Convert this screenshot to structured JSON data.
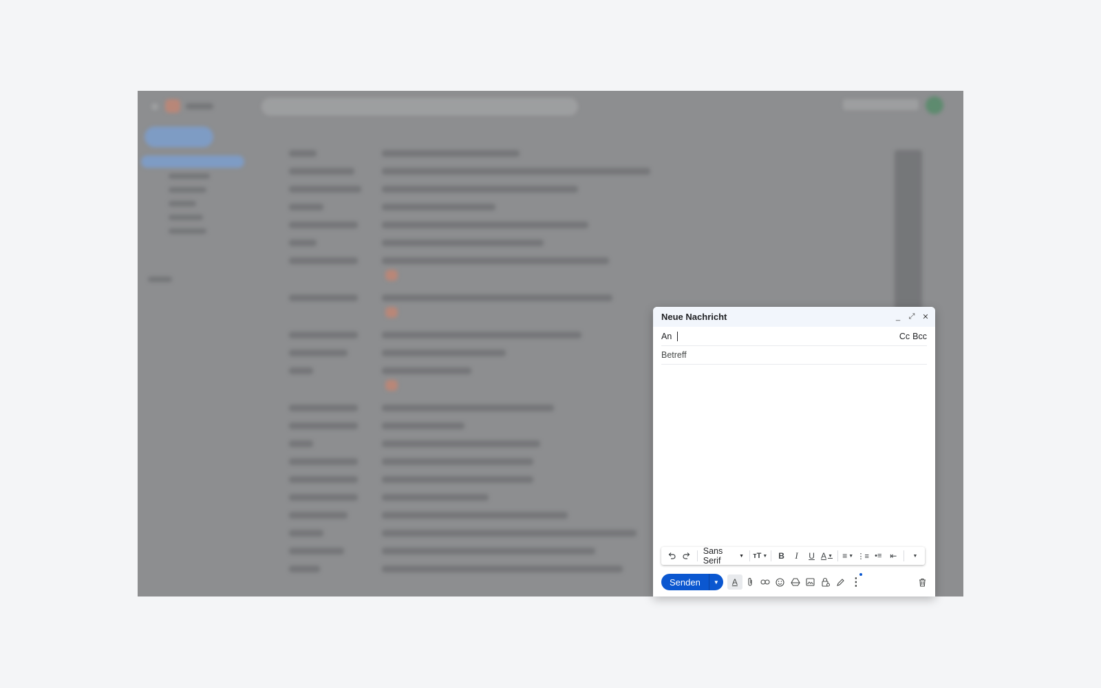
{
  "compose": {
    "title": "Neue Nachricht",
    "to_label": "An",
    "cc_label": "Cc",
    "bcc_label": "Bcc",
    "subject_placeholder": "Betreff",
    "font_name": "Sans Serif",
    "send_label": "Senden"
  },
  "header_icons": [
    "minimize-icon",
    "expand-icon",
    "close-icon"
  ],
  "toolbar_icons": [
    "undo-icon",
    "redo-icon",
    "font-size-icon",
    "bold-icon",
    "italic-icon",
    "underline-icon",
    "text-color-icon",
    "align-icon",
    "numbered-list-icon",
    "bulleted-list-icon",
    "indent-icon",
    "more-formatting-icon"
  ],
  "bottom_icons": [
    "formatting-options-icon",
    "attach-icon",
    "link-icon",
    "emoji-icon",
    "drive-icon",
    "photo-icon",
    "confidential-icon",
    "signature-icon",
    "more-options-icon",
    "discard-icon"
  ],
  "colors": {
    "send": "#0b57d0",
    "header_bg": "#f2f6fc",
    "background": "#f4f5f7"
  }
}
